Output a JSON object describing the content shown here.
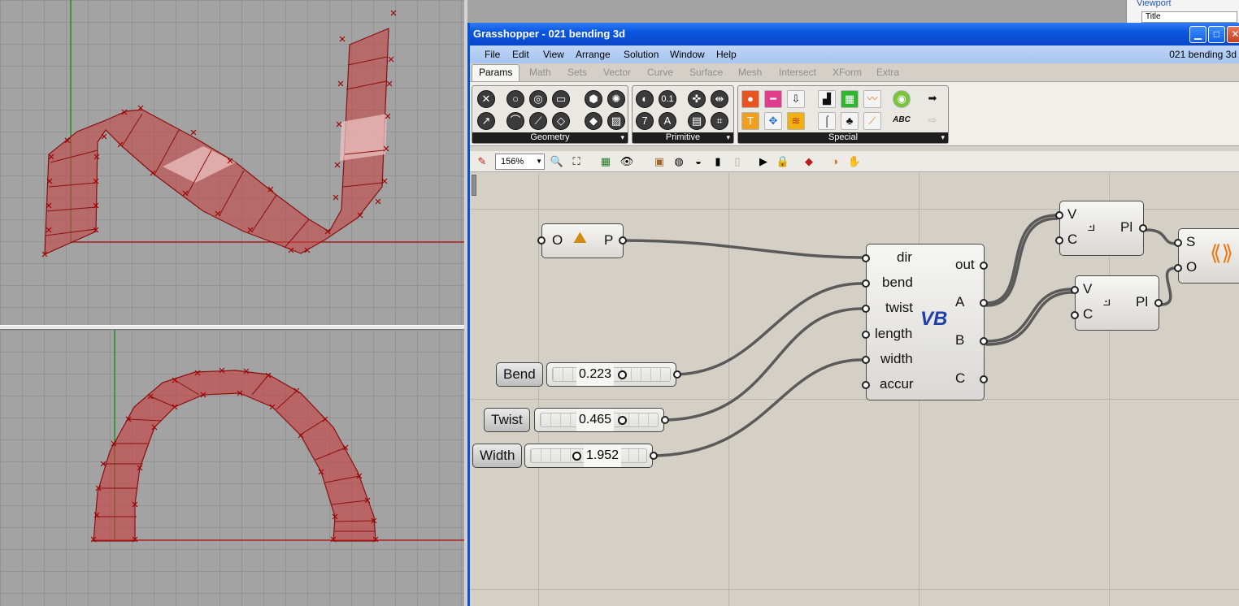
{
  "grasshopper": {
    "title": "Grasshopper - 021 bending 3d",
    "menu": [
      "File",
      "Edit",
      "View",
      "Arrange",
      "Solution",
      "Window",
      "Help"
    ],
    "doc_name": "021 bending 3d",
    "tabs": [
      "Params",
      "Math",
      "Sets",
      "Vector",
      "Curve",
      "Surface",
      "Mesh",
      "Intersect",
      "XForm",
      "Extra"
    ],
    "active_tab": "Params",
    "panels": [
      "Geometry",
      "Primitive",
      "Special"
    ],
    "zoom": "156%"
  },
  "rhino_panel": {
    "header": "Viewport",
    "title_field": "Title"
  },
  "icons": {
    "window_min": "minimize-icon",
    "window_max": "maximize-icon",
    "window_close": "close-icon"
  },
  "components": {
    "origin": {
      "in": "O",
      "out": "P"
    },
    "vb": {
      "inputs": [
        "dir",
        "bend",
        "twist",
        "length",
        "width",
        "accur"
      ],
      "outputs": [
        "out",
        "A",
        "B",
        "C"
      ],
      "logo": "VB"
    },
    "polyline1": {
      "inputs": [
        "V",
        "C"
      ],
      "output": "Pl"
    },
    "polyline2": {
      "inputs": [
        "V",
        "C"
      ],
      "output": "Pl"
    },
    "loft": {
      "inputs": [
        "S",
        "O"
      ]
    }
  },
  "sliders": [
    {
      "name": "Bend",
      "value": "0.223",
      "level": 0.45
    },
    {
      "name": "Twist",
      "value": "0.465",
      "level": 0.55
    },
    {
      "name": "Width",
      "value": "1.952",
      "level": 0.38
    }
  ],
  "colors": {
    "gh_title": "#0a56e0",
    "surface": "#c83c3c",
    "wire": "#6a6a6a"
  }
}
